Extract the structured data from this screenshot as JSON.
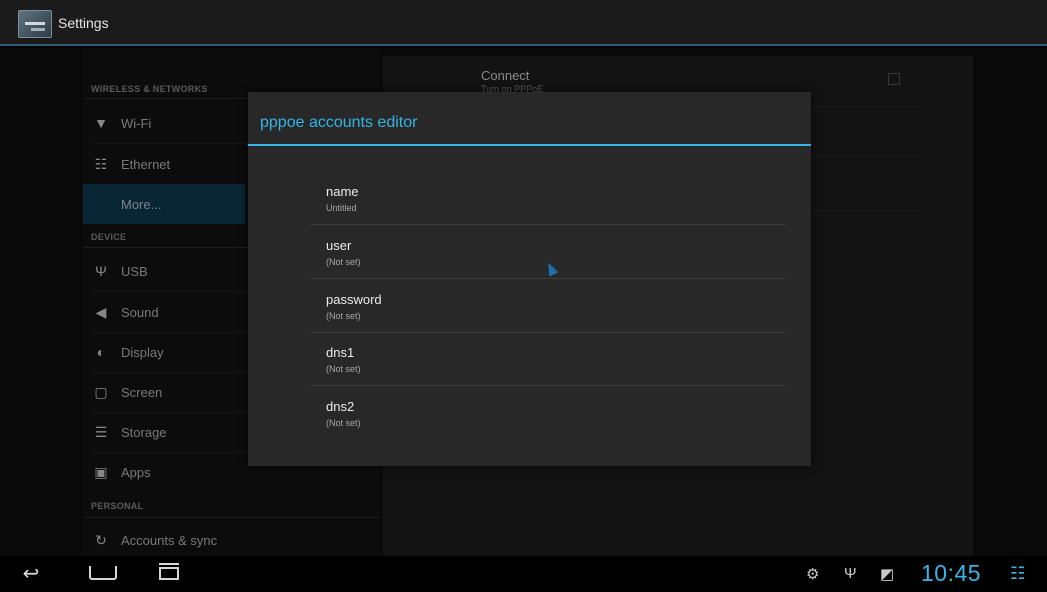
{
  "action_bar": {
    "title": "Settings",
    "icon": "settings-app-icon"
  },
  "sidebar": {
    "sections": [
      {
        "header": "WIRELESS & NETWORKS"
      },
      {
        "header": "DEVICE"
      },
      {
        "header": "PERSONAL"
      }
    ],
    "items": [
      {
        "label": "Wi-Fi",
        "icon": "wifi-icon"
      },
      {
        "label": "Ethernet",
        "icon": "ethernet-icon"
      },
      {
        "label": "More...",
        "selected": true
      },
      {
        "label": "USB",
        "icon": "usb-icon"
      },
      {
        "label": "Sound",
        "icon": "speaker-icon"
      },
      {
        "label": "Display",
        "icon": "display-icon"
      },
      {
        "label": "Screen",
        "icon": "screen-icon"
      },
      {
        "label": "Storage",
        "icon": "storage-icon"
      },
      {
        "label": "Apps",
        "icon": "apps-icon"
      },
      {
        "label": "Accounts & sync",
        "icon": "sync-icon"
      }
    ]
  },
  "right_pane": {
    "connect_title": "Connect",
    "connect_subtitle": "Turn on PPPoE"
  },
  "dialog": {
    "title": "pppoe accounts editor",
    "fields": [
      {
        "label": "name",
        "value": "Untitled"
      },
      {
        "label": "user",
        "value": "(Not set)"
      },
      {
        "label": "password",
        "value": "(Not set)"
      },
      {
        "label": "dns1",
        "value": "(Not set)"
      },
      {
        "label": "dns2",
        "value": "(Not set)"
      }
    ]
  },
  "system_bar": {
    "clock": "10:45",
    "status_icons": [
      "android-debug-icon",
      "usb-icon",
      "no-signal-icon",
      "ethernet-icon"
    ]
  },
  "colors": {
    "accent": "#33b5e5",
    "selected_bg": "#0f3b51"
  }
}
